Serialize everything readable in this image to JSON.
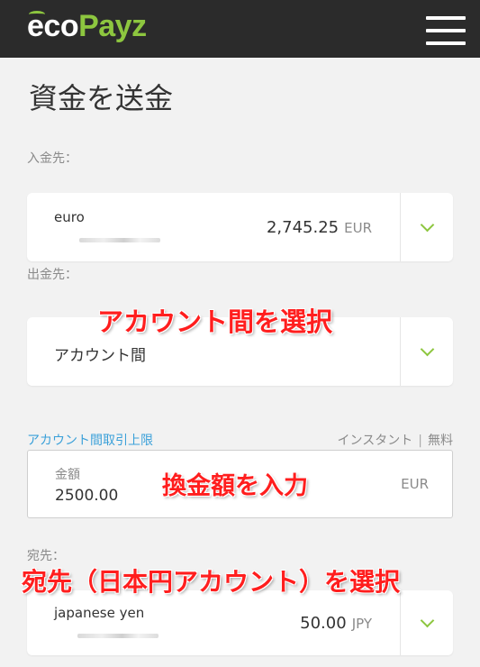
{
  "header": {
    "logo_eco": "eco",
    "logo_payz": "Payz",
    "menu_icon": "hamburger-menu-icon"
  },
  "page": {
    "title": "資金を送金"
  },
  "from_field": {
    "label": "入金先：",
    "account_name": "euro",
    "balance": "2,745.25",
    "currency": "EUR"
  },
  "to_field": {
    "label": "出金先：",
    "value": "アカウント間"
  },
  "limits": {
    "link": "アカウント間取引上限",
    "speed": "インスタント",
    "separator": "|",
    "fee": "無料"
  },
  "amount": {
    "label": "金額",
    "value": "2500.00",
    "currency": "EUR"
  },
  "dest_field": {
    "label": "宛先：",
    "account_name": "japanese yen",
    "balance": "50.00",
    "currency": "JPY"
  },
  "annotations": {
    "select_between_accounts": "アカウント間を選択",
    "enter_exchange_amount": "換金額を入力",
    "select_destination": "宛先（日本円アカウント）を選択"
  },
  "colors": {
    "header_bg": "#2b2b2b",
    "brand_green": "#8dc63f",
    "link_blue": "#3aa0d9",
    "annotation_red": "#ff1e1e",
    "page_bg": "#f2f2f2"
  }
}
